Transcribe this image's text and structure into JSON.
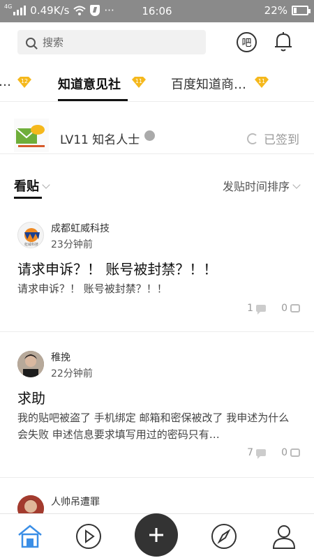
{
  "status": {
    "net_tag": "4G",
    "speed": "0.49K/s",
    "dots": "···",
    "time": "16:06",
    "battery": "22%",
    "battery_level": 0.22
  },
  "search": {
    "placeholder": "搜索"
  },
  "header": {
    "ba_label": "吧"
  },
  "tabs": [
    {
      "label": "…",
      "badge": "12"
    },
    {
      "label": "知道意见社",
      "badge": "11"
    },
    {
      "label": "百度知道商…",
      "badge": "11"
    }
  ],
  "level": {
    "text": "LV11  知名人士",
    "signed": "已签到"
  },
  "view": {
    "label": "看贴",
    "sort": "发贴时间排序"
  },
  "posts": [
    {
      "author": "成都虹威科技",
      "time": "23分钟前",
      "title": "请求申诉？！ 账号被封禁？！！",
      "body": "请求申诉？！ 账号被封禁？！！",
      "comments": "1",
      "likes": "0",
      "avatar_text": "虹威科技"
    },
    {
      "author": "稚挽",
      "time": "22分钟前",
      "title": "求助",
      "body": "我的贴吧被盗了 手机绑定 邮箱和密保被改了 我申述为什么会失败 申述信息要求填写用过的密码只有…",
      "comments": "7",
      "likes": "0"
    },
    {
      "author": "人帅吊遭罪",
      "time": ""
    }
  ],
  "colors": {
    "accent": "#111111",
    "badge": "#f5b81c",
    "status_bar": "#8a8a8a"
  },
  "icons": [
    "search-icon",
    "bell-icon",
    "home-icon",
    "play-icon",
    "plus-icon",
    "compass-icon",
    "profile-icon"
  ]
}
